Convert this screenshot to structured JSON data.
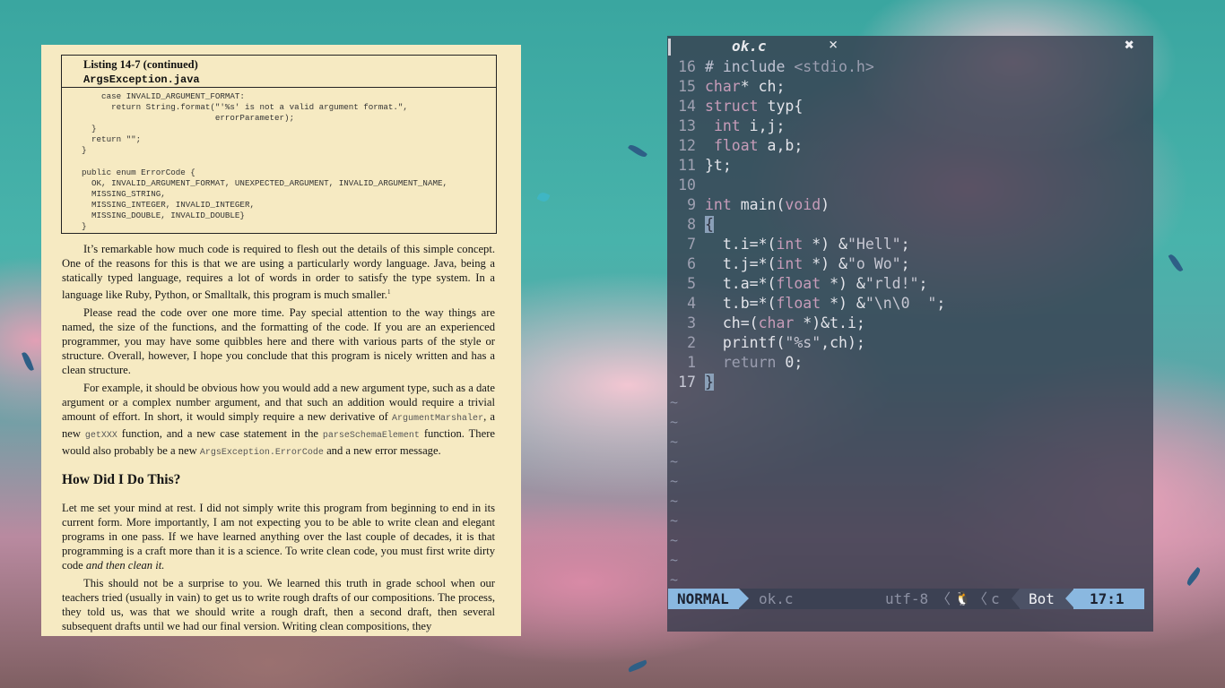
{
  "book": {
    "listing_title": "Listing 14-7 (continued)",
    "listing_file": "ArgsException.java",
    "code": [
      "    case INVALID_ARGUMENT_FORMAT:",
      "      return String.format(\"'%s' is not a valid argument format.\",",
      "                           errorParameter);",
      "  }",
      "  return \"\";",
      "}",
      "",
      "public enum ErrorCode {",
      "  OK, INVALID_ARGUMENT_FORMAT, UNEXPECTED_ARGUMENT, INVALID_ARGUMENT_NAME,",
      "  MISSING_STRING,",
      "  MISSING_INTEGER, INVALID_INTEGER,",
      "  MISSING_DOUBLE, INVALID_DOUBLE}",
      "}"
    ],
    "p1": "It’s remarkable how much code is required to flesh out the details of this simple concept. One of the reasons for this is that we are using a particularly wordy language. Java, being a statically typed language, requires a lot of words in order to satisfy the type system. In a language like Ruby, Python, or Smalltalk, this program is much smaller.",
    "p1_footnote": "1",
    "p2": "Please read the code over one more time. Pay special attention to the way things are named, the size of the functions, and the formatting of the code. If you are an experienced programmer, you may have some quibbles here and there with various parts of the style or structure. Overall, however, I hope you conclude that this program is nicely written and has a clean structure.",
    "p3_a": "For example, it should be obvious how you would add a new argument type, such as a date argument or a complex number argument, and that such an addition would require a trivial amount of effort. In short, it would simply require a new derivative of ",
    "p3_code1": "ArgumentMarshaler",
    "p3_b": ", a new ",
    "p3_code2": "getXXX",
    "p3_c": " function, and a new case statement in the ",
    "p3_code3": "parseSchemaElement",
    "p3_d": " function. There would also probably be a new ",
    "p3_code4": "ArgsException.ErrorCode",
    "p3_e": " and a new error message.",
    "heading": "How Did I Do This?",
    "p4_a": "Let me set your mind at rest. I did not simply write this program from beginning to end in its current form. More importantly, I am not expecting you to be able to write clean and elegant programs in one pass. If we have learned anything over the last couple of decades, it is that programming is a craft more than it is a science. To write clean code, you must first write dirty code ",
    "p4_em": "and then clean it.",
    "p5": "This should not be a surprise to you. We learned this truth in grade school when our teachers tried (usually in vain) to get us to write rough drafts of our compositions. The process, they told us, was that we should write a rough draft, then a second draft, then several subsequent drafts until we had our final version. Writing clean compositions, they"
  },
  "vim": {
    "tab_label": "ok.c",
    "tab_close": "×",
    "window_close": "✖",
    "lines": [
      {
        "num": "16",
        "code": [
          [
            "kw",
            "# include "
          ],
          [
            "dim",
            "<stdio.h>"
          ]
        ]
      },
      {
        "num": "15",
        "code": [
          [
            "ty",
            "char"
          ],
          [
            "",
            "* ch;"
          ]
        ]
      },
      {
        "num": "14",
        "code": [
          [
            "ty",
            "struct"
          ],
          [
            "",
            " typ{"
          ]
        ]
      },
      {
        "num": "13",
        "code": [
          [
            "",
            " "
          ],
          [
            "ty",
            "int"
          ],
          [
            "",
            " i,j;"
          ]
        ]
      },
      {
        "num": "12",
        "code": [
          [
            "",
            " "
          ],
          [
            "ty",
            "float"
          ],
          [
            "",
            " a,b;"
          ]
        ]
      },
      {
        "num": "11",
        "code": [
          [
            "",
            "}t;"
          ]
        ]
      },
      {
        "num": "10",
        "code": []
      },
      {
        "num": "9",
        "code": [
          [
            "ty",
            "int"
          ],
          [
            "",
            " main("
          ],
          [
            "ty",
            "void"
          ],
          [
            "",
            ")"
          ]
        ]
      },
      {
        "num": "8",
        "code": [
          [
            "cursorblk",
            "{"
          ]
        ]
      },
      {
        "num": "7",
        "code": [
          [
            "",
            "  t.i=*("
          ],
          [
            "ty",
            "int"
          ],
          [
            "",
            " *) &"
          ],
          [
            "str",
            "\"Hell\""
          ],
          [
            "",
            ";"
          ]
        ]
      },
      {
        "num": "6",
        "code": [
          [
            "",
            "  t.j=*("
          ],
          [
            "ty",
            "int"
          ],
          [
            "",
            " *) &"
          ],
          [
            "str",
            "\"o Wo\""
          ],
          [
            "",
            ";"
          ]
        ]
      },
      {
        "num": "5",
        "code": [
          [
            "",
            "  t.a=*("
          ],
          [
            "ty",
            "float"
          ],
          [
            "",
            " *) &"
          ],
          [
            "str",
            "\"rld!\""
          ],
          [
            "",
            ";"
          ]
        ]
      },
      {
        "num": "4",
        "code": [
          [
            "",
            "  t.b=*("
          ],
          [
            "ty",
            "float"
          ],
          [
            "",
            " *) &"
          ],
          [
            "str",
            "\"\\n\\0  \""
          ],
          [
            "",
            ";"
          ]
        ]
      },
      {
        "num": "3",
        "code": [
          [
            "",
            "  ch=("
          ],
          [
            "ty",
            "char"
          ],
          [
            "",
            " *)&t.i;"
          ]
        ]
      },
      {
        "num": "2",
        "code": [
          [
            "",
            "  printf("
          ],
          [
            "str",
            "\"%s\""
          ],
          [
            "",
            ",ch);"
          ]
        ]
      },
      {
        "num": "1",
        "code": [
          [
            "",
            "  "
          ],
          [
            "dim",
            "return"
          ],
          [
            "",
            " 0;"
          ]
        ]
      },
      {
        "num": "17",
        "code": [
          [
            "cursorblk",
            "}"
          ]
        ],
        "current": true
      }
    ],
    "tilde_count": 10,
    "tilde_char": "~",
    "status": {
      "mode": "NORMAL",
      "file": "ok.c",
      "encoding": "utf-8",
      "sep": "〈",
      "os_glyph": "🐧",
      "filetype": "c",
      "position": "Bot",
      "cursor": "17:1"
    }
  },
  "colors": {
    "book_bg": "#f6eac2",
    "vim_bg": "#373c4e",
    "mode_bg": "#8ab8e0",
    "type_color": "#c79cb9"
  }
}
